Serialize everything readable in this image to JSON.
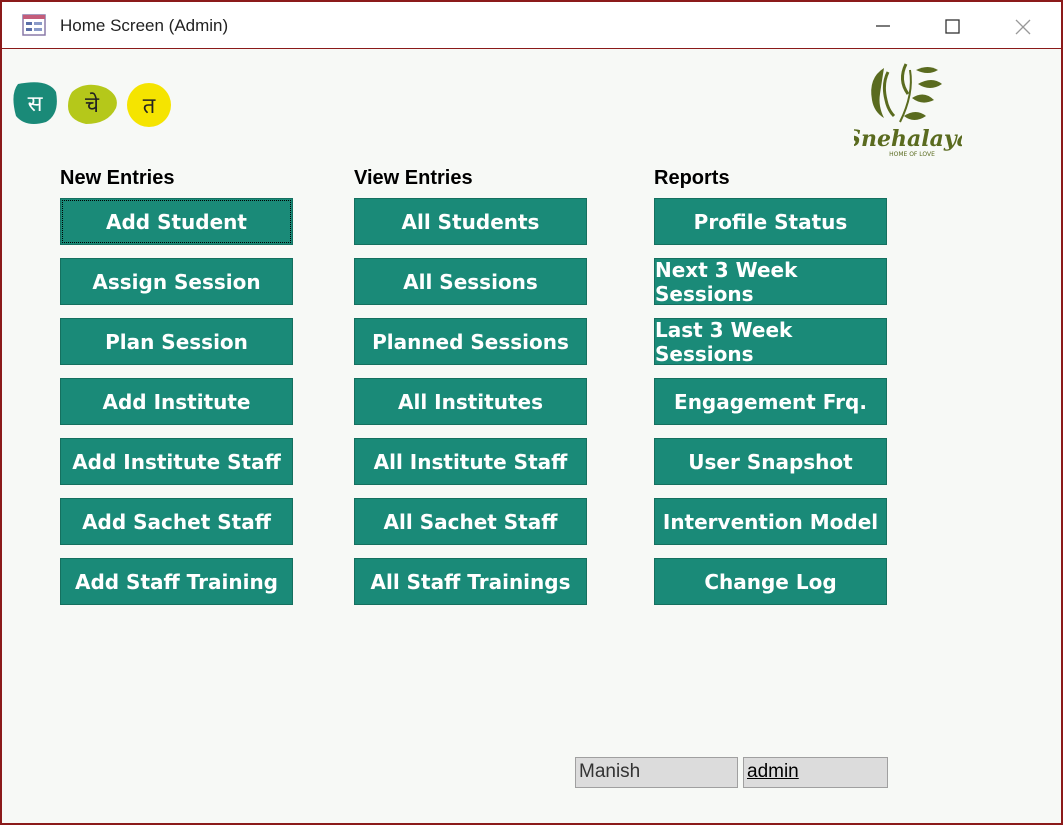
{
  "window": {
    "title": "Home Screen (Admin)",
    "border_color": "#8b1a1a",
    "background": "#f7f9f6"
  },
  "logos": {
    "letters": [
      "स",
      "चे",
      "त"
    ],
    "letter_colors": [
      "#1a8a78",
      "#b5c81a",
      "#f5e400"
    ],
    "brand_name": "Snehalaya",
    "brand_tagline": "HOME OF LOVE",
    "brand_color": "#5a6b1f"
  },
  "colors": {
    "button": "#1a8a78",
    "button_text": "#ffffff"
  },
  "columns": [
    {
      "heading": "New Entries",
      "buttons": [
        "Add Student",
        "Assign Session",
        "Plan Session",
        "Add Institute",
        "Add Institute Staff",
        "Add Sachet Staff",
        "Add Staff Training"
      ]
    },
    {
      "heading": "View Entries",
      "buttons": [
        "All Students",
        "All Sessions",
        "Planned Sessions",
        "All Institutes",
        "All Institute Staff",
        "All Sachet Staff",
        "All Staff Trainings"
      ]
    },
    {
      "heading": "Reports",
      "buttons": [
        "Profile Status",
        "Next 3 Week Sessions",
        "Last 3 Week Sessions",
        "Engagement Frq.",
        "User Snapshot",
        "Intervention Model",
        "Change Log"
      ]
    }
  ],
  "status": {
    "user_name": "Manish",
    "role": "admin"
  }
}
